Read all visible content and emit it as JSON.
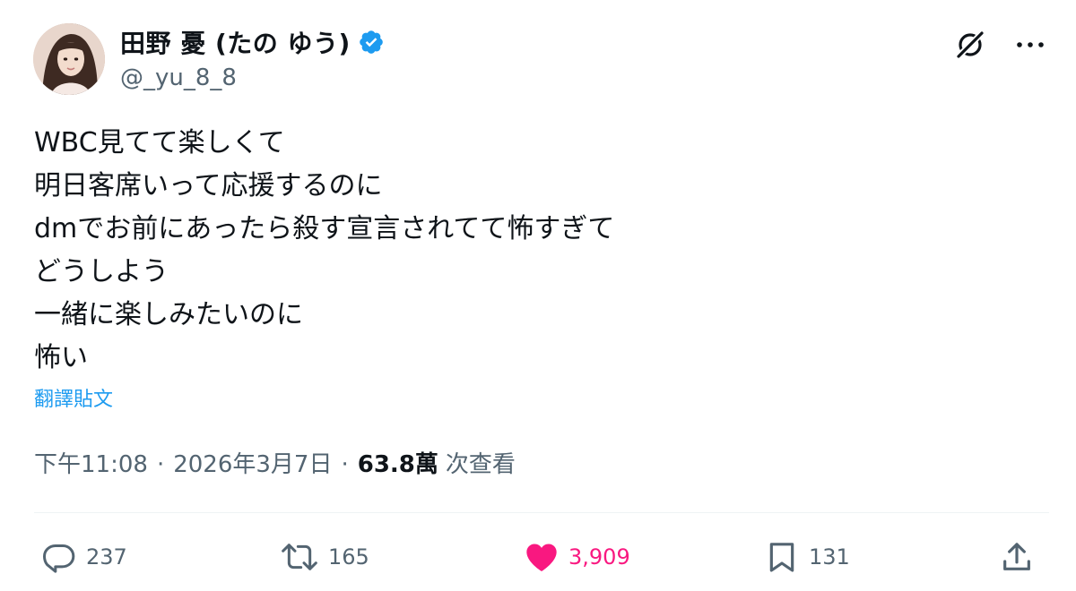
{
  "author": {
    "display_name": "田野 憂 (たの ゆう)",
    "handle": "@_yu_8_8",
    "verified_color": "#1d9bf0"
  },
  "header_icons": {
    "grok": "grok-slash-icon",
    "more": "more-icon"
  },
  "tweet": {
    "lines": [
      "WBC見てて楽しくて",
      "明日客席いって応援するのに",
      "dmでお前にあったら殺す宣言されてて怖すぎて",
      "どうしよう",
      "一緒に楽しみたいのに",
      "怖い"
    ],
    "translate_label": "翻譯貼文"
  },
  "meta": {
    "time": "下午11:08",
    "separator": "·",
    "date": "2026年3月7日",
    "views_count": "63.8萬",
    "views_label": "次查看"
  },
  "actions": {
    "reply": {
      "icon": "reply-icon",
      "count": "237"
    },
    "retweet": {
      "icon": "retweet-icon",
      "count": "165"
    },
    "like": {
      "icon": "heart-icon",
      "count": "3,909",
      "active_color": "#f91880"
    },
    "bookmark": {
      "icon": "bookmark-icon",
      "count": "131"
    },
    "share": {
      "icon": "share-icon"
    }
  }
}
